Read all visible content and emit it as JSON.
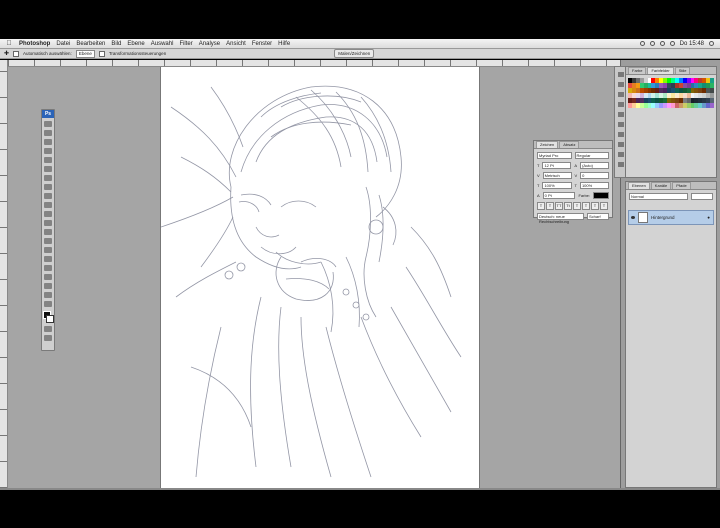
{
  "menubar": {
    "app": "Photoshop",
    "items": [
      "Datei",
      "Bearbeiten",
      "Bild",
      "Ebene",
      "Auswahl",
      "Filter",
      "Analyse",
      "Ansicht",
      "Fenster",
      "Hilfe"
    ],
    "clock": "Do 15:48"
  },
  "options": {
    "auto_select": "Automatisch auswählen:",
    "group_value": "Ebene",
    "transform": "Transformationssteuerungen",
    "workspace": "Malen/Zeichnen"
  },
  "char_panel": {
    "tabs": [
      "Zeichen",
      "Absatz"
    ],
    "font": "Myriad Pro",
    "style": "Regular",
    "size": "12 Pt",
    "leading": "(Auto)",
    "kerning": "Metrisch",
    "tracking": "0",
    "scale_v": "100%",
    "scale_h": "100%",
    "baseline": "0 Pt",
    "color_label": "Farbe:",
    "language": "Deutsch: neue Rechtschreibung",
    "aa": "Scharf"
  },
  "swatch_panel": {
    "tabs": [
      "Farbe",
      "Farbfelder",
      "Stile"
    ],
    "colors": [
      "#000000",
      "#3a3a3a",
      "#6b6b6b",
      "#9b9b9b",
      "#cfcfcf",
      "#ffffff",
      "#ff0000",
      "#ff7f00",
      "#ffff00",
      "#7fff00",
      "#00ff00",
      "#00ff7f",
      "#00ffff",
      "#007fff",
      "#0000ff",
      "#7f00ff",
      "#ff00ff",
      "#ff007f",
      "#c0392b",
      "#d35400",
      "#f1c40f",
      "#16a085",
      "#e74c3c",
      "#e67e22",
      "#f39c12",
      "#2ecc71",
      "#27ae60",
      "#1abc9c",
      "#3498db",
      "#2980b9",
      "#9b59b6",
      "#8e44ad",
      "#34495e",
      "#2c3e50",
      "#a93226",
      "#cb4335",
      "#884ea0",
      "#7d3c98",
      "#2471a3",
      "#2e86c1",
      "#17a589",
      "#138d75",
      "#229954",
      "#28b463",
      "#d4ac0d",
      "#d68910",
      "#ca6f1e",
      "#ba4a00",
      "#a04000",
      "#873600",
      "#6e2c00",
      "#641e16",
      "#512e5f",
      "#4a235a",
      "#154360",
      "#1b4f72",
      "#0e6251",
      "#0b5345",
      "#145a32",
      "#186a3b",
      "#7d6608",
      "#7e5109",
      "#784212",
      "#6e2c00",
      "#4d5656",
      "#424949",
      "#f5b7b1",
      "#fadbd8",
      "#e8daef",
      "#d2b4de",
      "#d6eaf8",
      "#aed6f1",
      "#d1f2eb",
      "#a3e4d7",
      "#d5f5e3",
      "#abebc6",
      "#fcf3cf",
      "#f9e79f",
      "#fdebd0",
      "#fad7a0",
      "#f6ddcc",
      "#edbb99",
      "#f2f3f4",
      "#e5e7e9",
      "#d7dbdd",
      "#ccd1d1",
      "#b3b6b7",
      "#979a9a",
      "#641e16",
      "#78281f",
      "#4a235a",
      "#512e5f",
      "#154360",
      "#1b4f72",
      "#0e6251",
      "#0b5345",
      "#145a32",
      "#186a3b",
      "#7d6608",
      "#7e5109",
      "#784212",
      "#6e2c00",
      "#7b7d7d",
      "#626567",
      "#17202a",
      "#1c2833",
      "#212f3c",
      "#273746",
      "#2e4053",
      "#566573",
      "#ff9999",
      "#ffcc99",
      "#ffff99",
      "#ccff99",
      "#99ff99",
      "#99ffcc",
      "#99ffff",
      "#99ccff",
      "#9999ff",
      "#cc99ff",
      "#ff99ff",
      "#ff99cc",
      "#cc6666",
      "#cc9966",
      "#cccc66",
      "#99cc66",
      "#66cc66",
      "#66cc99",
      "#66cccc",
      "#6699cc",
      "#6666cc",
      "#9966cc"
    ]
  },
  "layers_panel": {
    "tabs": [
      "Ebenen",
      "Kanäle",
      "Pfade"
    ],
    "blend": "Normal",
    "layer_name": "Hintergrund"
  }
}
